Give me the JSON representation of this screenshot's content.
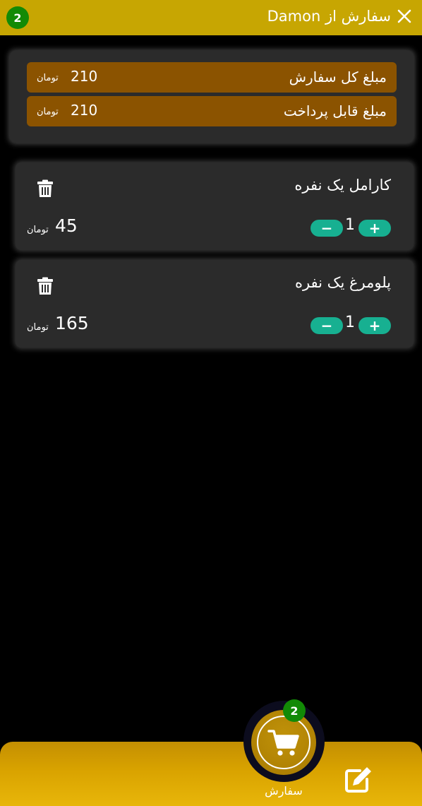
{
  "header": {
    "badge_count": "2",
    "title": "سفارش از Damon",
    "close_icon": "close-icon"
  },
  "summary": {
    "rows": [
      {
        "label": "مبلغ کل سفارش",
        "amount": "210",
        "unit": "تومان"
      },
      {
        "label": "مبلغ قابل پرداخت",
        "amount": "210",
        "unit": "تومان"
      }
    ]
  },
  "items": [
    {
      "name": "کارامل  یک نفره",
      "quantity": "1",
      "price": "45",
      "unit": "تومان",
      "plus": "+",
      "minus": "−"
    },
    {
      "name": "پلومرغ  یک نفره",
      "quantity": "1",
      "price": "165",
      "unit": "تومان",
      "plus": "+",
      "minus": "−"
    }
  ],
  "bottom_nav": {
    "cart_label": "سفارش",
    "cart_badge": "2",
    "cart_icon": "cart-icon",
    "edit_icon": "edit-icon"
  },
  "colors": {
    "header": "#c7a602",
    "summary_row": "#8b5300",
    "card": "#2b2b2b",
    "stepper": "#17b091",
    "badge": "#138a06"
  }
}
